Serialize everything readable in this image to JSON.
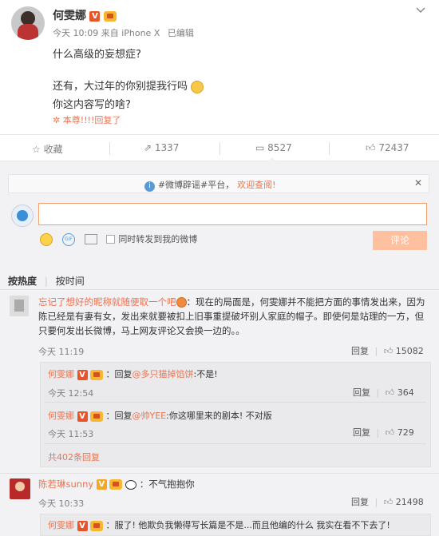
{
  "post": {
    "author": "何雯娜",
    "time_source": "今天 10:09 来自 iPhone X",
    "edited": "已编辑",
    "line1": "什么高级的妄想症?",
    "line2": "还有，大过年的你别提我行吗",
    "line3": "你这内容写的啥?",
    "reply_note": "本尊!!!!回复了"
  },
  "actions": {
    "collect": "收藏",
    "repost": "1337",
    "comment": "8527",
    "like": "72437"
  },
  "notice": {
    "text": "#微博辟谣#平台，",
    "link": "欢迎查阅!"
  },
  "composer": {
    "repost_label": "同时转发到我的微博",
    "submit": "评论"
  },
  "sort": {
    "hot": "按热度",
    "time": "按时间"
  },
  "comments": [
    {
      "name": "忘记了想好的昵称就随便取一个吧",
      "text": "：现在的局面是，何雯娜并不能把方面的事情发出来，因为陈已经是有妻有女，发出来就要被扣上旧事重提破坏别人家庭的帽子。即使何是站理的一方，但只要何发出长微博，马上网友评论又会换一边的。。",
      "time": "今天 11:19",
      "reply": "回复",
      "likes": "15082",
      "replies": [
        {
          "name": "何雯娜",
          "text": "：回复",
          "mention": "@多只猫掉馅饼",
          "rest": ":不是!",
          "time": "今天 12:54",
          "reply": "回复",
          "likes": "364"
        },
        {
          "name": "何雯娜",
          "text": "：回复",
          "mention": "@帅YEE",
          "rest": ":你这哪里来的剧本! 不对版",
          "time": "今天 11:53",
          "reply": "回复",
          "likes": "729"
        }
      ],
      "more": "共402条回复"
    },
    {
      "name": "陈若琳sunny",
      "text": "：不气抱抱你",
      "time": "今天 10:33",
      "reply": "回复",
      "likes": "21498",
      "replies": [
        {
          "name": "何雯娜",
          "text": "：服了! 他欺负我懒得写长篇是不是...而且他编的什么 我实在看不下去了!"
        }
      ]
    }
  ]
}
